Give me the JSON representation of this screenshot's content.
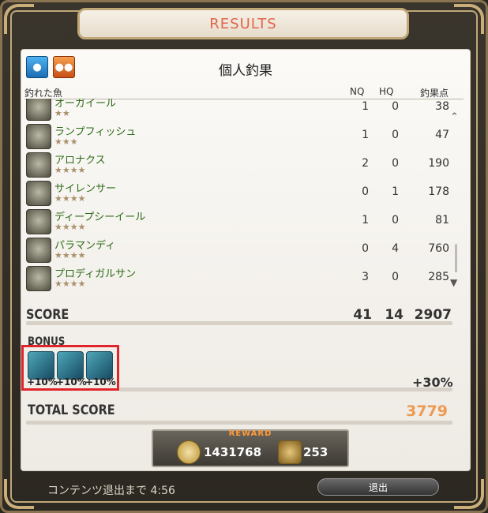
{
  "window": {
    "title": "RESULTS"
  },
  "header": {
    "title": "個人釣果"
  },
  "columns": {
    "fish": "釣れた魚",
    "nq": "NQ",
    "hq": "HQ",
    "score": "釣果点"
  },
  "fish": [
    {
      "name": "オーガイール",
      "stars": "★★",
      "nq": "1",
      "hq": "0",
      "score": "38",
      "icon": "fish-icon"
    },
    {
      "name": "ランプフィッシュ",
      "stars": "★★★",
      "nq": "1",
      "hq": "0",
      "score": "47",
      "icon": "fish-icon"
    },
    {
      "name": "アロナクス",
      "stars": "★★★★",
      "nq": "2",
      "hq": "0",
      "score": "190",
      "icon": "fish-icon"
    },
    {
      "name": "サイレンサー",
      "stars": "★★★★",
      "nq": "0",
      "hq": "1",
      "score": "178",
      "icon": "fish-icon"
    },
    {
      "name": "ディープシーイール",
      "stars": "★★★★",
      "nq": "1",
      "hq": "0",
      "score": "81",
      "icon": "fish-icon"
    },
    {
      "name": "パラマンディ",
      "stars": "★★★★",
      "nq": "0",
      "hq": "4",
      "score": "760",
      "icon": "fish-icon"
    },
    {
      "name": "プロディガルサン",
      "stars": "★★★★",
      "nq": "3",
      "hq": "0",
      "score": "285",
      "icon": "fish-icon"
    }
  ],
  "score": {
    "label": "SCORE",
    "nq": "41",
    "hq": "14",
    "total": "2907"
  },
  "bonus": {
    "label": "BONUS",
    "items": [
      {
        "pct": "+10%",
        "icon": "bonus-icon-1"
      },
      {
        "pct": "+10%",
        "icon": "bonus-icon-2"
      },
      {
        "pct": "+10%",
        "icon": "bonus-icon-3"
      }
    ],
    "total": "+30%"
  },
  "total_score": {
    "label": "TOTAL SCORE",
    "value": "3779"
  },
  "reward": {
    "label": "REWARD",
    "mgp": "1431768",
    "scrip": "253"
  },
  "footer": {
    "timer": "コンテンツ退出まで 4:56",
    "exit_label": "退出"
  },
  "colors": {
    "title": "#e1654a",
    "fish_name": "#2d6b18",
    "total": "#ee9a52",
    "highlight": "#e0242a"
  }
}
